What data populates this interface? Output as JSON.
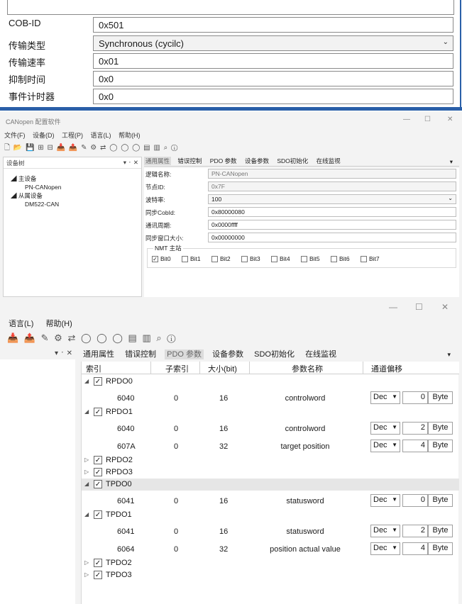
{
  "panel1": {
    "rows": [
      {
        "label": "COB-ID",
        "value": "0x501"
      },
      {
        "label": "传输类型",
        "value": "Synchronous (cycilc)"
      },
      {
        "label": "传输速率",
        "value": "0x01"
      },
      {
        "label": "抑制时间",
        "value": "0x0"
      },
      {
        "label": "事件计时器",
        "value": "0x0"
      }
    ],
    "dropdown_arrow": "⌄"
  },
  "panel2": {
    "title": "CANopen 配置软件",
    "window_controls": {
      "min": "—",
      "max": "☐",
      "close": "✕"
    },
    "menu": [
      "文件(F)",
      "设备(D)",
      "工程(P)",
      "语言(L)",
      "帮助(H)"
    ],
    "tree": {
      "header": "设备树",
      "header_controls": "▾ ᛫ ✕",
      "items": [
        {
          "text": "◢ 主设备",
          "indent": 10
        },
        {
          "text": "PN-CANopen",
          "indent": 30
        },
        {
          "text": "◢ 从属设备",
          "indent": 10
        },
        {
          "text": "DM522-CAN",
          "indent": 30
        }
      ]
    },
    "tabs": [
      "通用属性",
      "错误控制",
      "PDO 参数",
      "设备参数",
      "SDO初始化",
      "在线监视"
    ],
    "tabs_more": "▾",
    "fields": [
      {
        "label": "逻辑名称:",
        "value": "PN-CANopen",
        "readonly": true
      },
      {
        "label": "节点ID:",
        "value": "0x7F",
        "readonly": true
      },
      {
        "label": "波特率:",
        "value": "100",
        "dropdown": true
      },
      {
        "label": "同步CobId:",
        "value": "0x80000080"
      },
      {
        "label": "通讯周期:",
        "value": "0x0000ffff"
      },
      {
        "label": "同步窗口大小:",
        "value": "0x00000000"
      }
    ],
    "nmt": {
      "title": "NMT 主站",
      "bits": [
        {
          "label": "Bit0",
          "checked": true
        },
        {
          "label": "Bit1",
          "checked": false
        },
        {
          "label": "Bit2",
          "checked": false
        },
        {
          "label": "Bit3",
          "checked": false
        },
        {
          "label": "Bit4",
          "checked": false
        },
        {
          "label": "Bit5",
          "checked": false
        },
        {
          "label": "Bit6",
          "checked": false
        },
        {
          "label": "Bit7",
          "checked": false
        }
      ]
    }
  },
  "panel3": {
    "window_controls": {
      "min": "—",
      "max": "☐",
      "close": "✕"
    },
    "menu": [
      "语言(L)",
      "帮助(H)"
    ],
    "pane_controls": "▾ ᛫ ✕",
    "tabs": [
      "通用属性",
      "错误控制",
      "PDO 参数",
      "设备参数",
      "SDO初始化",
      "在线监视"
    ],
    "active_tab": 2,
    "tabs_more": "▾",
    "columns": {
      "index": "索引",
      "subindex": "子索引",
      "size": "大小(bit)",
      "param_name": "参数名称",
      "offset": "通道偏移"
    },
    "groups": [
      {
        "name": "RPDO0",
        "expanded": true,
        "checked": true,
        "selected": false,
        "entries": [
          {
            "index": "6040",
            "sub": "0",
            "size": "16",
            "name": "controlword",
            "format": "Dec",
            "offset": "0",
            "unit": "Byte"
          }
        ]
      },
      {
        "name": "RPDO1",
        "expanded": true,
        "checked": true,
        "selected": false,
        "entries": [
          {
            "index": "6040",
            "sub": "0",
            "size": "16",
            "name": "controlword",
            "format": "Dec",
            "offset": "2",
            "unit": "Byte"
          },
          {
            "index": "607A",
            "sub": "0",
            "size": "32",
            "name": "target position",
            "format": "Dec",
            "offset": "4",
            "unit": "Byte"
          }
        ]
      },
      {
        "name": "RPDO2",
        "expanded": false,
        "checked": true,
        "selected": false,
        "entries": []
      },
      {
        "name": "RPDO3",
        "expanded": false,
        "checked": true,
        "selected": false,
        "entries": []
      },
      {
        "name": "TPDO0",
        "expanded": true,
        "checked": true,
        "selected": true,
        "entries": [
          {
            "index": "6041",
            "sub": "0",
            "size": "16",
            "name": "statusword",
            "format": "Dec",
            "offset": "0",
            "unit": "Byte"
          }
        ]
      },
      {
        "name": "TPDO1",
        "expanded": true,
        "checked": true,
        "selected": false,
        "entries": [
          {
            "index": "6041",
            "sub": "0",
            "size": "16",
            "name": "statusword",
            "format": "Dec",
            "offset": "2",
            "unit": "Byte"
          },
          {
            "index": "6064",
            "sub": "0",
            "size": "32",
            "name": "position actual value",
            "format": "Dec",
            "offset": "4",
            "unit": "Byte"
          }
        ]
      },
      {
        "name": "TPDO2",
        "expanded": false,
        "checked": true,
        "selected": false,
        "entries": []
      },
      {
        "name": "TPDO3",
        "expanded": false,
        "checked": true,
        "selected": false,
        "entries": []
      }
    ]
  }
}
